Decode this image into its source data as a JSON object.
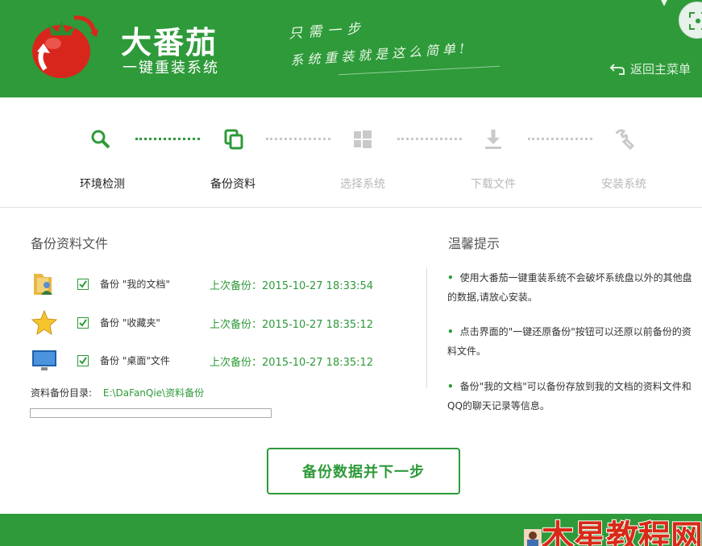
{
  "header": {
    "brand_title": "大番茄",
    "brand_subtitle": "一键重装系统",
    "slogan_line1": "只需一步",
    "slogan_line2": "系统重装就是这么简单!",
    "back_label": "返回主菜单",
    "accent_color": "#2e9a3a"
  },
  "steps": [
    {
      "label": "环境检测",
      "icon": "search-icon",
      "state": "done"
    },
    {
      "label": "备份资料",
      "icon": "copy-icon",
      "state": "current"
    },
    {
      "label": "选择系统",
      "icon": "windows-icon",
      "state": "pending"
    },
    {
      "label": "下载文件",
      "icon": "download-icon",
      "state": "pending"
    },
    {
      "label": "安装系统",
      "icon": "wrench-icon",
      "state": "pending"
    }
  ],
  "backup": {
    "title": "备份资料文件",
    "items": [
      {
        "label": "备份 \"我的文档\"",
        "last_backup": "上次备份：2015-10-27 18:33:54",
        "checked": true,
        "icon": "documents-folder-icon"
      },
      {
        "label": "备份 \"收藏夹\"",
        "last_backup": "上次备份：2015-10-27 18:35:12",
        "checked": true,
        "icon": "favorites-star-icon"
      },
      {
        "label": "备份 \"桌面\"文件",
        "last_backup": "上次备份：2015-10-27 18:35:12",
        "checked": true,
        "icon": "desktop-monitor-icon"
      }
    ],
    "directory_label": "资料备份目录:",
    "directory_path": "E:\\DaFanQie\\资料备份",
    "progress": 0
  },
  "tips": {
    "title": "温馨提示",
    "items": [
      "使用大番茄一键重装系统不会破坏系统盘以外的其他盘的数据,请放心安装。",
      "点击界面的\"一键还原备份\"按钮可以还原以前备份的资料文件。",
      "备份\"我的文档\"可以备份存放到我的文档的资料文件和QQ的聊天记录等信息。"
    ]
  },
  "main_button": "备份数据并下一步",
  "watermark": "木星教程网"
}
